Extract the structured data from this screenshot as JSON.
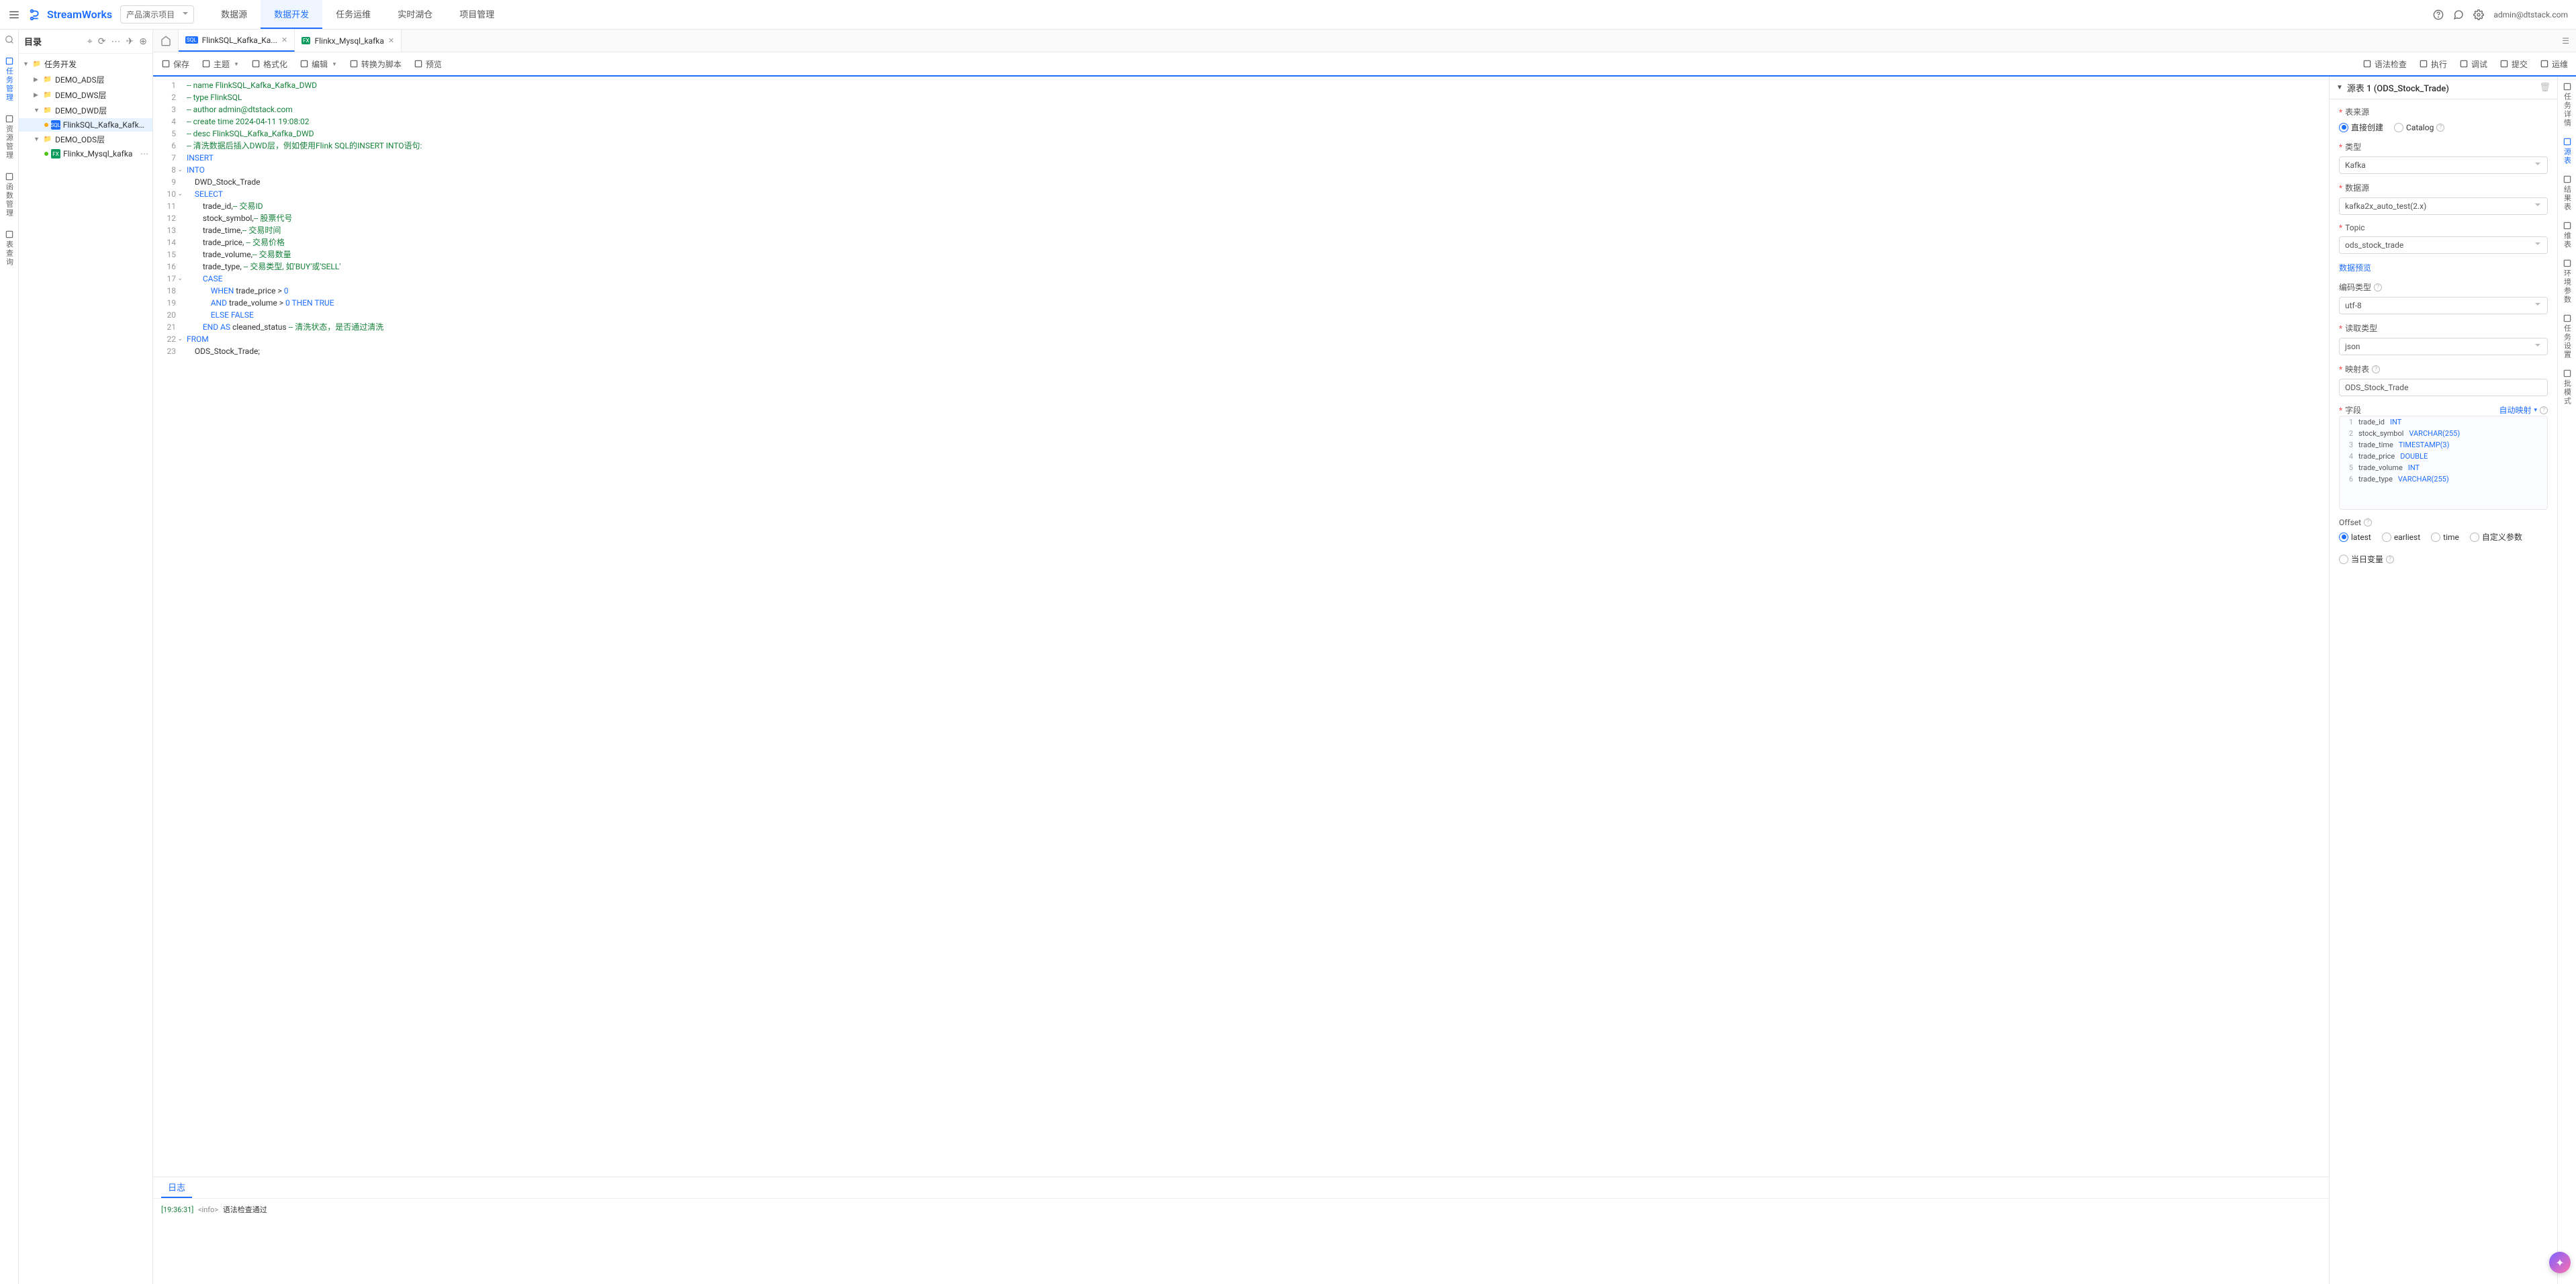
{
  "header": {
    "brand": "StreamWorks",
    "project": "产品演示项目",
    "nav": [
      "数据源",
      "数据开发",
      "任务运维",
      "实时湖仓",
      "项目管理"
    ],
    "activeNav": 1,
    "user": "admin@dtstack.com"
  },
  "leftRail": [
    {
      "label": "任务管理",
      "active": true
    },
    {
      "label": "资源管理",
      "active": false
    },
    {
      "label": "函数管理",
      "active": false
    },
    {
      "label": "表查询",
      "active": false
    }
  ],
  "tree": {
    "title": "目录",
    "root": "任务开发",
    "nodes": [
      {
        "name": "DEMO_ADS层",
        "type": "folder",
        "depth": 1,
        "expanded": false
      },
      {
        "name": "DEMO_DWS层",
        "type": "folder",
        "depth": 1,
        "expanded": false
      },
      {
        "name": "DEMO_DWD层",
        "type": "folder",
        "depth": 1,
        "expanded": true
      },
      {
        "name": "FlinkSQL_Kafka_Kafka_...",
        "type": "sql",
        "depth": 2,
        "status": "yellow",
        "selected": true
      },
      {
        "name": "DEMO_ODS层",
        "type": "folder",
        "depth": 1,
        "expanded": true
      },
      {
        "name": "Flinkx_Mysql_kafka",
        "type": "fx",
        "depth": 2,
        "status": "green",
        "more": true
      }
    ]
  },
  "fileTabs": [
    {
      "label": "FlinkSQL_Kafka_Ka...",
      "icon": "sql",
      "active": true
    },
    {
      "label": "Flinkx_Mysql_kafka",
      "icon": "fx",
      "active": false
    }
  ],
  "toolbar": {
    "left": [
      {
        "label": "保存",
        "icon": "save"
      },
      {
        "label": "主题",
        "icon": "theme",
        "caret": true
      },
      {
        "label": "格式化",
        "icon": "format"
      },
      {
        "label": "编辑",
        "icon": "edit",
        "caret": true
      },
      {
        "label": "转换为脚本",
        "icon": "convert"
      },
      {
        "label": "预览",
        "icon": "preview"
      }
    ],
    "right": [
      {
        "label": "语法检查",
        "icon": "check"
      },
      {
        "label": "执行",
        "icon": "run"
      },
      {
        "label": "调试",
        "icon": "debug"
      },
      {
        "label": "提交",
        "icon": "submit"
      },
      {
        "label": "运维",
        "icon": "ops"
      }
    ]
  },
  "code": [
    {
      "n": 1,
      "t": "-- name FlinkSQL_Kafka_Kafka_DWD",
      "cls": "c-comment"
    },
    {
      "n": 2,
      "t": "-- type FlinkSQL",
      "cls": "c-comment"
    },
    {
      "n": 3,
      "t": "-- author admin@dtstack.com",
      "cls": "c-comment"
    },
    {
      "n": 4,
      "t": "-- create time 2024-04-11 19:08:02",
      "cls": "c-comment"
    },
    {
      "n": 5,
      "t": "-- desc FlinkSQL_Kafka_Kafka_DWD",
      "cls": "c-comment"
    },
    {
      "n": 6,
      "t": "-- 清洗数据后插入DWD层，例如使用Flink SQL的INSERT INTO语句:",
      "cls": "c-comment"
    },
    {
      "n": 7,
      "html": "<span class='c-keyword'>INSERT</span>"
    },
    {
      "n": 8,
      "html": "<span class='c-keyword'>INTO</span>",
      "fold": true
    },
    {
      "n": 9,
      "html": "    DWD_Stock_Trade"
    },
    {
      "n": 10,
      "html": "    <span class='c-keyword'>SELECT</span>",
      "fold": true
    },
    {
      "n": 11,
      "html": "        trade_id,<span class='c-comment'>-- 交易ID</span>"
    },
    {
      "n": 12,
      "html": "        stock_symbol,<span class='c-comment'>-- 股票代号</span>"
    },
    {
      "n": 13,
      "html": "        trade_time,<span class='c-comment'>-- 交易时间</span>"
    },
    {
      "n": 14,
      "html": "        trade_price, <span class='c-comment'>-- 交易价格</span>"
    },
    {
      "n": 15,
      "html": "        trade_volume,<span class='c-comment'>-- 交易数量</span>"
    },
    {
      "n": 16,
      "html": "        trade_type, <span class='c-comment'>-- 交易类型, 如'BUY'或'SELL'</span>"
    },
    {
      "n": 17,
      "html": "        <span class='c-keyword'>CASE</span>",
      "fold": true
    },
    {
      "n": 18,
      "html": "            <span class='c-keyword'>WHEN</span> trade_price &gt; <span class='c-num'>0</span>"
    },
    {
      "n": 19,
      "html": "            <span class='c-keyword'>AND</span> trade_volume &gt; <span class='c-num'>0</span> <span class='c-keyword'>THEN</span> <span class='c-keyword'>TRUE</span>"
    },
    {
      "n": 20,
      "html": "            <span class='c-keyword'>ELSE</span> <span class='c-keyword'>FALSE</span>"
    },
    {
      "n": 21,
      "html": "        <span class='c-keyword'>END AS</span> cleaned_status <span class='c-comment'>-- 清洗状态，是否通过清洗</span>"
    },
    {
      "n": 22,
      "html": "<span class='c-keyword'>FROM</span>",
      "fold": true
    },
    {
      "n": 23,
      "html": "    ODS_Stock_Trade;"
    }
  ],
  "log": {
    "tab": "日志",
    "ts": "[19:36:31]",
    "tag": "<info>",
    "msg": "语法检查通过"
  },
  "config": {
    "title": "源表 1 (ODS_Stock_Trade)",
    "sourceLabel": "表来源",
    "sourceOptions": [
      "直接创建",
      "Catalog"
    ],
    "sourceSelected": 0,
    "typeLabel": "类型",
    "typeValue": "Kafka",
    "dsLabel": "数据源",
    "dsValue": "kafka2x_auto_test(2.x)",
    "topicLabel": "Topic",
    "topicValue": "ods_stock_trade",
    "previewLink": "数据预览",
    "encodeLabel": "编码类型",
    "encodeValue": "utf-8",
    "readLabel": "读取类型",
    "readValue": "json",
    "mapLabel": "映射表",
    "mapValue": "ODS_Stock_Trade",
    "fieldLabel": "字段",
    "autoMap": "自动映射",
    "fields": [
      {
        "i": 1,
        "name": "trade_id",
        "type": "INT"
      },
      {
        "i": 2,
        "name": "stock_symbol",
        "type": "VARCHAR(255)"
      },
      {
        "i": 3,
        "name": "trade_time",
        "type": "TIMESTAMP(3)"
      },
      {
        "i": 4,
        "name": "trade_price",
        "type": "DOUBLE"
      },
      {
        "i": 5,
        "name": "trade_volume",
        "type": "INT"
      },
      {
        "i": 6,
        "name": "trade_type",
        "type": "VARCHAR(255)"
      }
    ],
    "offsetLabel": "Offset",
    "offsetOptions": [
      "latest",
      "earliest",
      "time",
      "自定义参数",
      "当日变量"
    ],
    "offsetSelected": 0
  },
  "rightRail": [
    "任务详情",
    "源表",
    "结果表",
    "维表",
    "环境参数",
    "任务设置",
    "批模式"
  ],
  "rightRailActive": 1
}
